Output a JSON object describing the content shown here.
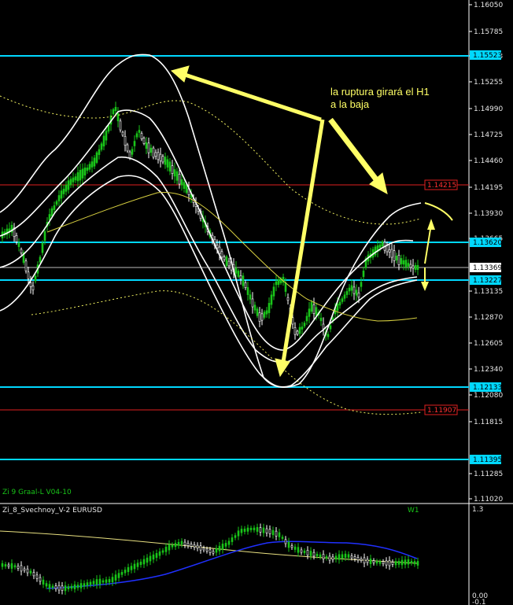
{
  "symbol": "EURUSD",
  "timeframe": "W1",
  "main_indicator_label": "Zi 9 Graal-L V04-10",
  "sub_indicator_label": "Zi_8_Svechnoy_V-2 EURUSD",
  "annotation": {
    "line1": "la ruptura girará el H1",
    "line2": "a la baja"
  },
  "price_axis": {
    "ticks": [
      "1.16050",
      "1.15785",
      "1.15523",
      "1.15255",
      "1.14990",
      "1.14725",
      "1.14460",
      "1.14195",
      "1.14215",
      "1.13930",
      "1.13665",
      "1.13620",
      "1.13369",
      "1.13227",
      "1.13135",
      "1.12870",
      "1.12605",
      "1.12340",
      "1.12133",
      "1.12080",
      "1.11907",
      "1.11815",
      "1.11395",
      "1.11285",
      "1.11020"
    ]
  },
  "levels": {
    "l1": {
      "label": "1.15523",
      "color": "#00d8ff"
    },
    "l2": {
      "label": "1.14215",
      "color": "#ff3030"
    },
    "l3": {
      "label": "1.13620",
      "color": "#00d8ff"
    },
    "cur": {
      "label": "1.13369",
      "color": "#ffffff"
    },
    "l4": {
      "label": "1.13227",
      "color": "#00d8ff"
    },
    "l5": {
      "label": "1.12133",
      "color": "#00d8ff"
    },
    "l6": {
      "label": "1.11907",
      "color": "#ff3030"
    },
    "l7": {
      "label": "1.11395",
      "color": "#00d8ff"
    }
  },
  "sub_axis": {
    "top": "1.3",
    "bottom": "0.00",
    "bottom2": "-0.1"
  },
  "colors": {
    "candle_up": "#19c519",
    "candle_down": "#ffffff",
    "annotation": "#ffff66",
    "band": "#ffffff",
    "mid_dotted": "#f0f060",
    "sub_blue": "#2030ff",
    "sub_yellow": "#e8e080"
  }
}
